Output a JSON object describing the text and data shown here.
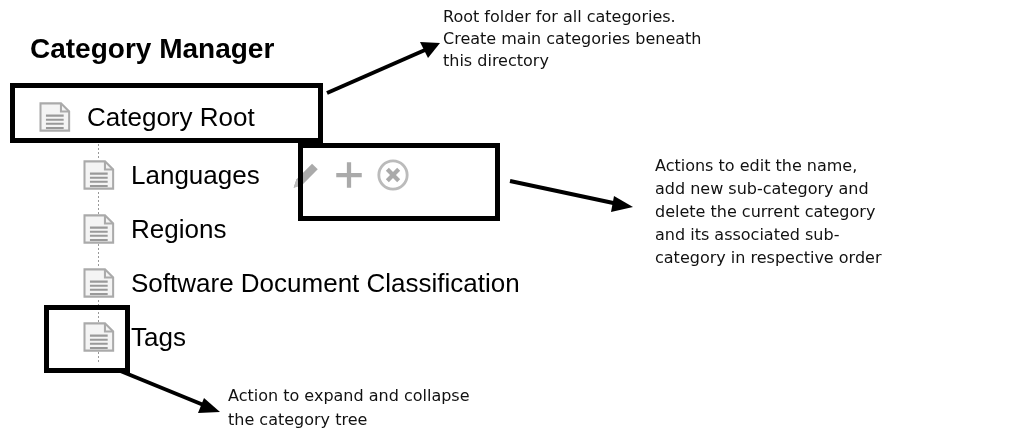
{
  "title": "Category Manager",
  "tree": {
    "label": "Category Root",
    "hovered": false,
    "children": [
      {
        "label": "Languages",
        "hovered": true
      },
      {
        "label": "Regions",
        "hovered": false
      },
      {
        "label": "Software Document Classification",
        "hovered": false
      },
      {
        "label": "Tags",
        "hovered": false
      }
    ]
  },
  "annotations": [
    {
      "text": "Root folder for all categories.\nCreate main categories beneath\nthis directory"
    },
    {
      "text": "Actions to edit the name,\nadd new sub-category and\ndelete the current category\nand its associated sub-\ncategory in respective order"
    },
    {
      "text": "Action to expand and collapse\nthe category tree"
    }
  ]
}
